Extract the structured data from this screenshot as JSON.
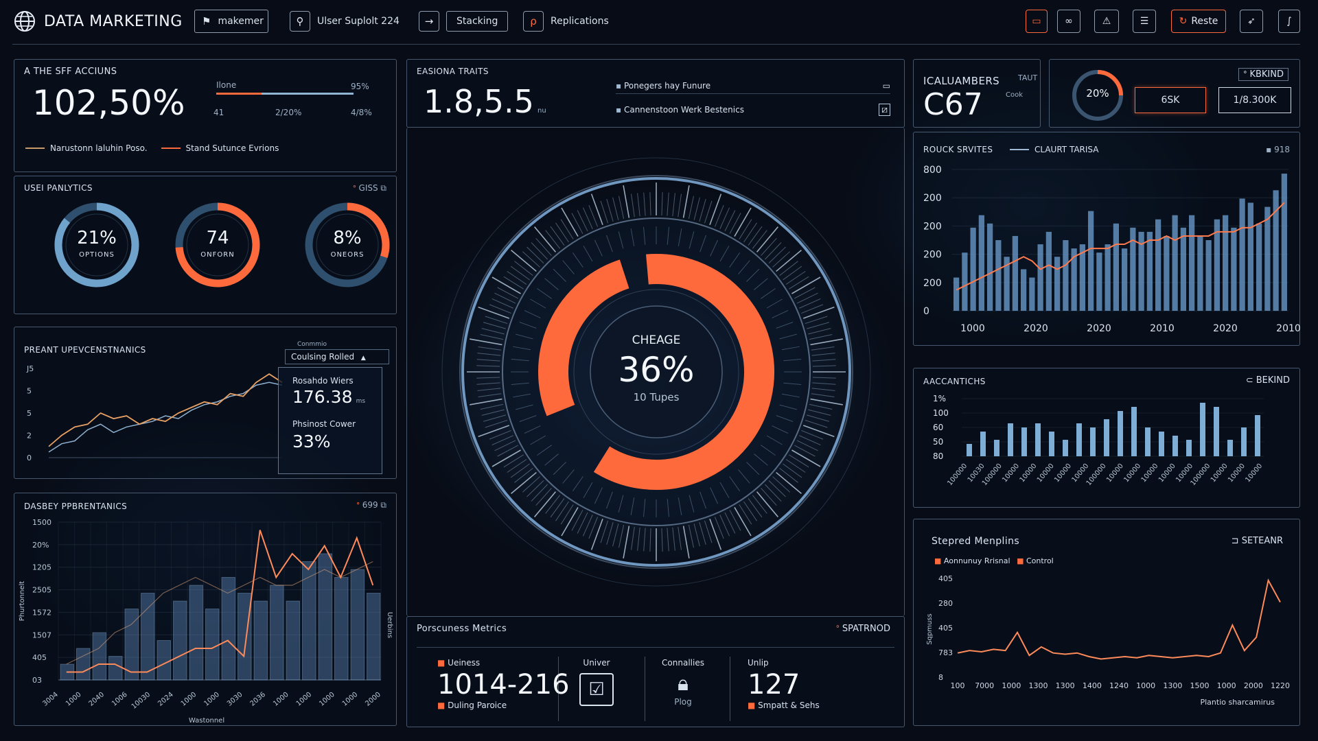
{
  "app": {
    "title": "DATA MARKETING"
  },
  "nav": {
    "items": [
      {
        "label": "makemer",
        "icon": "flag-icon"
      },
      {
        "label": "Ulser Suplolt 224",
        "icon": "user-icon"
      },
      {
        "label": "Stacking",
        "icon": "arrow-right-icon"
      },
      {
        "label": "Replications",
        "icon": "link-icon"
      }
    ],
    "tools": {
      "tablet": "tablet-icon",
      "infinity": "infinity-icon",
      "warning": "warning-icon",
      "report": "report-icon",
      "reset_label": "Reste",
      "send": "send-icon",
      "script": "script-icon"
    }
  },
  "p1": {
    "title": "A THE SFF ACCIUNS",
    "value": "102,50%",
    "bar_label": "Ilone",
    "bar_fill": 0.33,
    "bar_right": "95%",
    "tick_left": "41",
    "tick_mid": "2/20%",
    "tick_right": "4/8%",
    "legend": [
      "Narustonn laluhin Poso.",
      "Stand Sutunce Evrions"
    ]
  },
  "p2": {
    "title": "EASIONA TRAITS",
    "value": "1.8,5.5",
    "unit": "nu",
    "items": [
      "Ponegers hay Funure",
      "Cannenstoon Werk Bestenics"
    ]
  },
  "p3": {
    "title": "ICALUAMBERS",
    "value": "C67",
    "tag1": "TAUT",
    "tag2": "Cook"
  },
  "p4": {
    "ring_value": "20%",
    "ring_fill": 0.25,
    "badge": "KBKIND",
    "box1": "6SK",
    "box2": "1/8.300K"
  },
  "user_analytics": {
    "title": "USEI PANLYTICS",
    "header_right": "GISS",
    "rings": [
      {
        "value": "21%",
        "label": "OPTIONS",
        "fill": 0.86,
        "color": "#6fa3cc"
      },
      {
        "value": "74",
        "label": "ONFORN",
        "fill": 0.74,
        "color": "#ff6a3d"
      },
      {
        "value": "8%",
        "label": "ONEORS",
        "fill": 0.3,
        "color": "#ff6a3d"
      }
    ]
  },
  "predict": {
    "title": "PREANT UPEVCENSTNANICS",
    "dropdown_top": "Conmmio",
    "dropdown": "Coulsing Rolled",
    "y_ticks": [
      "J5",
      "5",
      "5",
      "2",
      "0"
    ],
    "box_label1": "Rosahdo Wiers",
    "box_value1": "176.38",
    "box_unit1": "ms",
    "box_label2": "Phsinost Cower",
    "box_value2": "33%",
    "series_orange": [
      4,
      8,
      11,
      12,
      16,
      14,
      15,
      12,
      14,
      13,
      16,
      18,
      20,
      19,
      23,
      22,
      27,
      30,
      27
    ],
    "series_blue": [
      2,
      5,
      6,
      10,
      12,
      9,
      11,
      12,
      13,
      15,
      14,
      17,
      19,
      20,
      22,
      23,
      26,
      27,
      26
    ]
  },
  "dasbey": {
    "title": "DASBEY PPBRENTANICS",
    "header_right": "699",
    "y_ticks": [
      "1500",
      "20%",
      "1205",
      "2505",
      "1572",
      "1507",
      "405",
      "03"
    ],
    "ylabel": "Phurtonnelt",
    "x_ticks": [
      "3004",
      "1000",
      "2040",
      "1006",
      "10030",
      "2024",
      "1000",
      "1000",
      "3030",
      "2036",
      "1000",
      "1000",
      "1000",
      "1000",
      "2000"
    ],
    "xlabel": "Wastonnel",
    "right_label": "Uerbins",
    "bars": [
      2,
      4,
      6,
      3,
      9,
      11,
      5,
      10,
      12,
      9,
      13,
      11,
      10,
      12,
      10,
      15,
      16,
      13,
      14,
      11
    ],
    "line_orange": [
      1,
      1,
      2,
      2,
      1,
      1,
      2,
      3,
      4,
      4,
      5,
      3,
      19,
      13,
      16,
      14,
      17,
      13,
      18,
      12
    ],
    "line_faint": [
      2,
      3,
      4,
      6,
      7,
      9,
      11,
      12,
      13,
      12,
      11,
      12,
      13,
      12,
      12,
      13,
      14,
      13,
      14,
      15
    ]
  },
  "center": {
    "label": "CHEAGE",
    "value": "36%",
    "sub": "10 Tupes"
  },
  "metrics": {
    "title": "Porscuness Metrics",
    "header_right": "SPATRNOD",
    "m1_label": "Ueiness",
    "m1_value": "1014-216",
    "m1_sub": "Duling Paroice",
    "m2_label": "Univer",
    "m3_label": "Connallies",
    "m3_sub": "Plog",
    "m4_label": "Unlip",
    "m4_value": "127",
    "m4_sub": "Smpatt & Sehs"
  },
  "rouck": {
    "title": "ROUCK SRVITES",
    "legend": "CLAURT TARISA",
    "header_right": "918",
    "y_ticks": [
      "800",
      "200",
      "200",
      "200",
      "200",
      "0"
    ],
    "x_ticks": [
      "1000",
      "2020",
      "2020",
      "2010",
      "2020",
      "2010"
    ],
    "bars": [
      8,
      14,
      20,
      23,
      21,
      17,
      13,
      18,
      10,
      8,
      16,
      19,
      13,
      17,
      15,
      16,
      24,
      14,
      16,
      21,
      15,
      20,
      19,
      19,
      22,
      18,
      23,
      20,
      23,
      18,
      17,
      22,
      23,
      20,
      27,
      26,
      21,
      25,
      29,
      33
    ],
    "line": [
      5,
      6,
      7,
      8,
      9,
      10,
      11,
      12,
      13,
      12,
      10,
      11,
      10,
      11,
      13,
      14,
      15,
      15,
      15,
      16,
      16,
      17,
      16,
      17,
      17,
      18,
      17,
      18,
      18,
      18,
      18,
      19,
      19,
      19,
      20,
      20,
      21,
      22,
      24,
      26
    ]
  },
  "accantics": {
    "title": "AACCANTICHS",
    "header_right": "BEKIND",
    "y_ticks": [
      "1%",
      "100",
      "60",
      "50",
      "80"
    ],
    "x_ticks": [
      "100000",
      "10030",
      "100000",
      "10000",
      "10000",
      "10000",
      "10000",
      "10000",
      "100000",
      "10000",
      "10000",
      "10000",
      "10000",
      "10000",
      "100000",
      "10000",
      "10000",
      "10000"
    ],
    "bars": [
      3,
      6,
      4,
      8,
      7,
      8,
      6,
      4,
      8,
      7,
      9,
      11,
      12,
      7,
      6,
      5,
      4,
      13,
      12,
      4,
      7,
      10
    ]
  },
  "stepred": {
    "title": "Stepred Menplins",
    "header_right": "SETEANR",
    "legend": [
      "Aonnunuy Rrisnal",
      "Control"
    ],
    "y_ticks": [
      "405",
      "280",
      "405",
      "783",
      "8"
    ],
    "ylabel": "Sqpmuss",
    "x_ticks": [
      "100",
      "7000",
      "1000",
      "1300",
      "1300",
      "1400",
      "1240",
      "1000",
      "1300",
      "1500",
      "1000",
      "2000",
      "1220"
    ],
    "xlabel": "Plantio sharcamirus",
    "line": [
      20,
      22,
      21,
      23,
      22,
      37,
      18,
      25,
      20,
      19,
      20,
      17,
      15,
      16,
      17,
      16,
      18,
      17,
      16,
      17,
      18,
      17,
      20,
      43,
      22,
      33,
      80,
      62
    ]
  }
}
